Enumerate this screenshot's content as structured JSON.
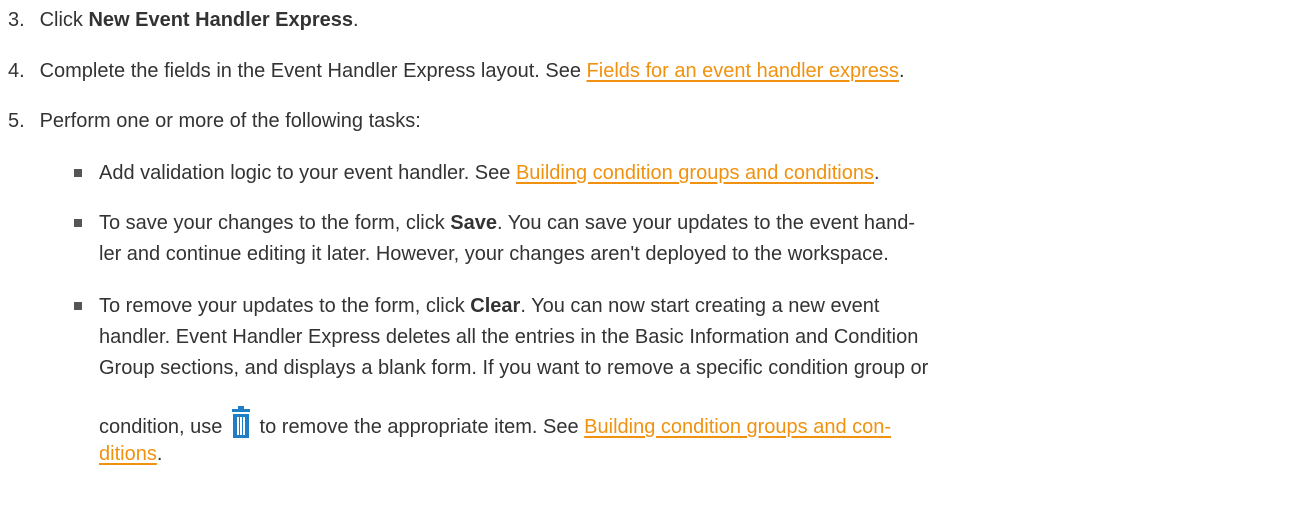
{
  "steps": [
    {
      "num": "3.",
      "pre": "Click ",
      "bold": "New Event Handler Express",
      "post": "."
    },
    {
      "num": "4.",
      "pre": "Complete the fields in the Event Handler Express layout. See ",
      "link": "Fields for an event handler express",
      "post": "."
    },
    {
      "num": "5.",
      "text": "Perform one or more of the following tasks:"
    }
  ],
  "bullets": {
    "b1": {
      "pre": "Add validation logic to your event handler. See ",
      "link": "Building condition groups and conditions",
      "post": "."
    },
    "b2": {
      "line1_pre": "To save your changes to the form, click ",
      "line1_bold": "Save",
      "line1_post": ". You can save your updates to the event hand-",
      "line2": "ler and continue editing it later. However, your changes aren't deployed to the workspace."
    },
    "b3": {
      "line1_pre": "To remove your updates to the form, click ",
      "line1_bold": "Clear",
      "line1_post": ". You can now start creating a new event",
      "line2": "handler. Event Handler Express deletes all the entries in the Basic Information and Condition",
      "line3": "Group sections, and displays a blank form. If you want to remove a specific condition group or",
      "line4_pre": "condition, use ",
      "line4_mid": " to remove the appropriate item. See ",
      "line4_link": "Building condition groups and con-",
      "line5_link": "ditions",
      "line5_post": "."
    }
  },
  "icons": {
    "trash": "trash-icon",
    "trash_color": "#1f7fc6"
  },
  "colors": {
    "link": "#f0920f",
    "text": "#333333"
  }
}
